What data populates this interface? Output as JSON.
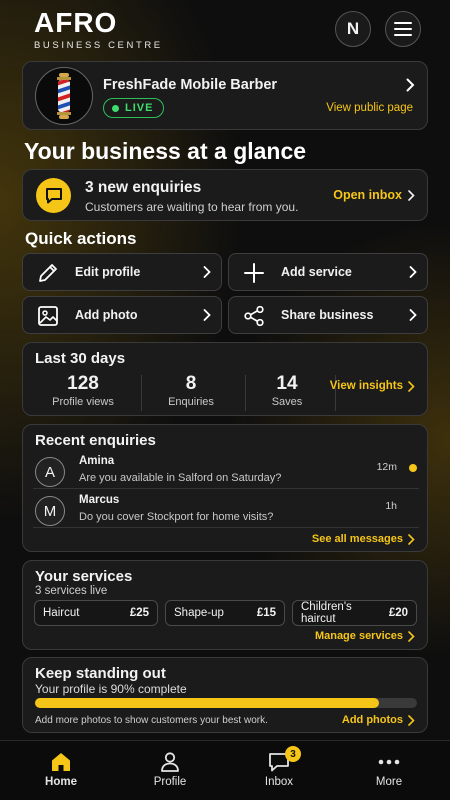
{
  "header": {
    "logo_main": "AFRO",
    "logo_sub": "BUSINESS CENTRE",
    "avatar_initial": "N"
  },
  "business": {
    "name": "FreshFade Mobile Barber",
    "status": "LIVE",
    "view_link": "View public page"
  },
  "page_title": "Your business at a glance",
  "alert": {
    "title": "3 new enquiries",
    "subtitle": "Customers are waiting to hear from you.",
    "action": "Open inbox"
  },
  "quick_actions": {
    "title": "Quick actions",
    "items": [
      {
        "label": "Edit profile",
        "icon": "pencil-icon"
      },
      {
        "label": "Add service",
        "icon": "plus-icon"
      },
      {
        "label": "Add photo",
        "icon": "image-icon"
      },
      {
        "label": "Share business",
        "icon": "share-icon"
      }
    ]
  },
  "stats": {
    "title": "Last 30 days",
    "items": [
      {
        "value": "128",
        "label": "Profile views"
      },
      {
        "value": "8",
        "label": "Enquiries"
      },
      {
        "value": "14",
        "label": "Saves"
      }
    ],
    "action": "View insights"
  },
  "recent_enquiries": {
    "title": "Recent enquiries",
    "items": [
      {
        "initial": "A",
        "name": "Amina",
        "message": "Are you available in Salford on Saturday?",
        "time": "12m",
        "unread": true
      },
      {
        "initial": "M",
        "name": "Marcus",
        "message": "Do you cover Stockport for home visits?",
        "time": "1h",
        "unread": false
      }
    ],
    "action": "See all messages"
  },
  "services": {
    "title": "Your services",
    "subtitle": "3 services live",
    "items": [
      {
        "name": "Haircut",
        "price": "£25"
      },
      {
        "name": "Shape-up",
        "price": "£15"
      },
      {
        "name": "Children's haircut",
        "price": "£20"
      }
    ],
    "action": "Manage services"
  },
  "standout": {
    "title": "Keep standing out",
    "subtitle": "Your profile is 90% complete",
    "progress": 0.9,
    "note": "Add more photos to show customers your best work.",
    "action": "Add photos"
  },
  "nav": {
    "items": [
      {
        "label": "Home",
        "icon": "home-icon",
        "active": true
      },
      {
        "label": "Profile",
        "icon": "user-icon"
      },
      {
        "label": "Inbox",
        "icon": "chat-icon",
        "badge": "3"
      },
      {
        "label": "More",
        "icon": "more-icon"
      }
    ]
  },
  "colors": {
    "accent": "#f5c518",
    "live": "#3ddc6d",
    "card_bg": "#1b1b1b"
  }
}
